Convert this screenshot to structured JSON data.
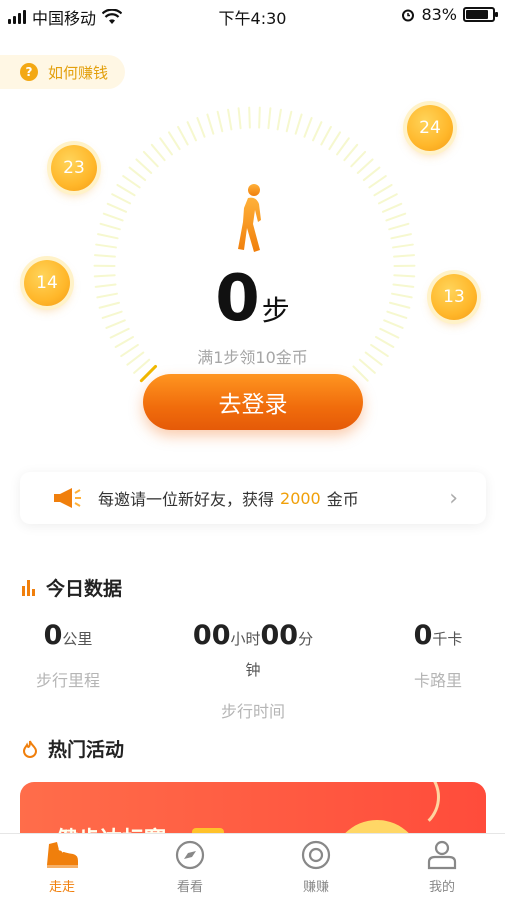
{
  "status_bar": {
    "carrier": "中国移动",
    "time": "下午4:30",
    "battery": "83%",
    "battery_level": 0.83
  },
  "help": {
    "label": "如何赚钱"
  },
  "coins": [
    "23",
    "24",
    "14",
    "13"
  ],
  "pedometer": {
    "steps": "0",
    "unit": "步",
    "reward_hint": "满1步领10金币",
    "login_label": "去登录"
  },
  "invite": {
    "prefix": "每邀请一位新好友，获得",
    "amount": "2000",
    "suffix": "金币"
  },
  "today": {
    "title": "今日数据",
    "distance": {
      "value": "0",
      "unit": "公里",
      "label": "步行里程"
    },
    "time": {
      "hours": "00",
      "hours_unit": "小时",
      "minutes": "00",
      "minutes_unit": "分钟",
      "label": "步行时间"
    },
    "calories": {
      "value": "0",
      "unit": "千卡",
      "label": "卡路里"
    }
  },
  "hot": {
    "title": "热门活动",
    "banner_title": "健步达标赛"
  },
  "tabs": [
    {
      "label": "走走",
      "icon": "shoe-icon"
    },
    {
      "label": "看看",
      "icon": "compass-icon"
    },
    {
      "label": "赚赚",
      "icon": "coin-target-icon"
    },
    {
      "label": "我的",
      "icon": "person-icon"
    }
  ],
  "colors": {
    "accent": "#f07f0c",
    "gold": "#f0a00a",
    "banner": "#ff5a40"
  }
}
